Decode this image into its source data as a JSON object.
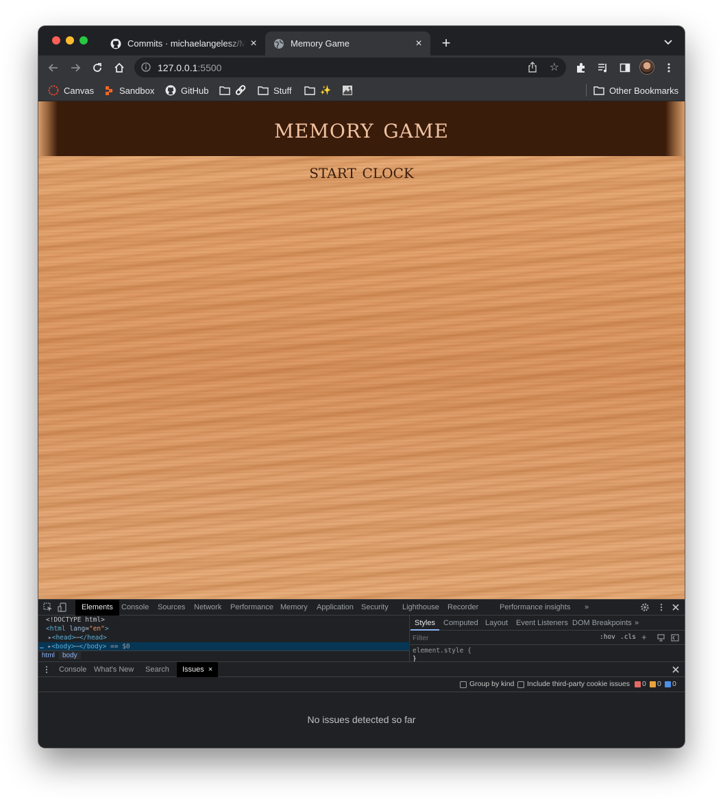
{
  "window": {
    "tabs": [
      {
        "title": "Commits · michaelangelesz/Memory-Game",
        "favicon": "github-icon",
        "active": false
      },
      {
        "title": "Memory Game",
        "favicon": "globe-icon",
        "active": true
      }
    ],
    "new_tab": "+"
  },
  "toolbar": {
    "url_host": "127.0.0.1",
    "url_port": ":5500"
  },
  "bookmarks": {
    "items": [
      {
        "label": "Canvas",
        "icon": "canvas-icon"
      },
      {
        "label": "Sandbox",
        "icon": "sandbox-icon"
      },
      {
        "label": "GitHub",
        "icon": "github-icon"
      },
      {
        "label": "🔗",
        "icon": "folder-icon"
      },
      {
        "label": "Stuff",
        "icon": "folder-icon"
      },
      {
        "label": "✨",
        "icon": "folder-icon"
      },
      {
        "label": "",
        "icon": "image-icon"
      }
    ],
    "other": "Other Bookmarks"
  },
  "page": {
    "title": "Memory Game",
    "start_clock": "Start Clock"
  },
  "devtools": {
    "tabs": [
      "Elements",
      "Console",
      "Sources",
      "Network",
      "Performance",
      "Memory",
      "Application",
      "Security",
      "Lighthouse",
      "Recorder",
      "Performance insights"
    ],
    "more": "»",
    "elements": {
      "doctype": "<!DOCTYPE html>",
      "html_open": "<html",
      "lang_attr": "lang",
      "lang_val": "\"en\"",
      "gt": ">",
      "head": "<head>",
      "head_close": "</head>",
      "body": "<body>",
      "body_close": "</body>",
      "selected_marker": "== $0",
      "ellipsis": "…",
      "collapsed": "⋯"
    },
    "breadcrumbs": [
      "html",
      "body"
    ],
    "styles_tabs": [
      "Styles",
      "Computed",
      "Layout",
      "Event Listeners",
      "DOM Breakpoints"
    ],
    "filter_placeholder": "Filter",
    "hov": ":hov",
    "cls": ".cls",
    "element_style": "element.style {",
    "close_brace": "}",
    "drawer_tabs": [
      "Console",
      "What's New",
      "Search",
      "Issues"
    ],
    "group_by_kind": "Group by kind",
    "third_party": "Include third-party cookie issues",
    "counts": {
      "errors": "0",
      "warnings": "0",
      "info": "0"
    },
    "no_issues": "No issues detected so far"
  }
}
